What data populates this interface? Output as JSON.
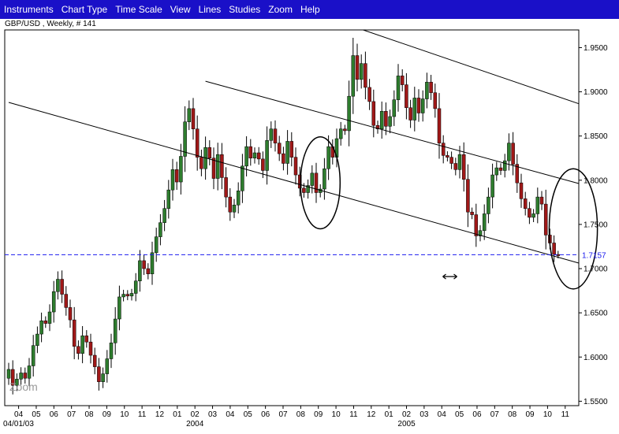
{
  "menu": {
    "items": [
      "Instruments",
      "Chart Type",
      "Time Scale",
      "View",
      "Lines",
      "Studies",
      "Zoom",
      "Help"
    ]
  },
  "chart_title": "GBP/USD , Weekly, # 141",
  "zoom_label": "Zoom",
  "colors": {
    "menubar": "#1a10c8",
    "up_candle": "#2e7d2e",
    "down_candle": "#a01818",
    "price_line": "#1a1aee",
    "trendline": "#000000"
  },
  "chart_data": {
    "type": "candlestick",
    "instrument": "GBP/USD",
    "timeframe": "Weekly",
    "bar_count": 141,
    "ylim": [
      1.545,
      1.97
    ],
    "y_ticks": [
      "1.9500",
      "1.9000",
      "1.8500",
      "1.8000",
      "1.7500",
      "1.7000",
      "1.6500",
      "1.6000",
      "1.5500"
    ],
    "y_tick_values": [
      1.95,
      1.9,
      1.85,
      1.8,
      1.75,
      1.7,
      1.65,
      1.6,
      1.55
    ],
    "current_price_label": "1.7157",
    "current_price": 1.7157,
    "x_month_labels": [
      "04",
      "05",
      "06",
      "07",
      "08",
      "09",
      "10",
      "11",
      "12",
      "01",
      "02",
      "03",
      "04",
      "05",
      "06",
      "07",
      "08",
      "09",
      "10",
      "11",
      "12",
      "01",
      "02",
      "03",
      "04",
      "05",
      "06",
      "07",
      "08",
      "09",
      "10",
      "11"
    ],
    "x_month_positions": [
      0.5,
      4.8,
      9.1,
      13.4,
      17.7,
      22,
      26.3,
      30.6,
      34.9,
      39.2,
      43.5,
      47.8,
      52.1,
      56.4,
      60.7,
      65,
      69.3,
      73.6,
      77.9,
      82.2,
      86.5,
      90.8,
      95.1,
      99.4,
      103.7,
      108,
      112.3,
      116.6,
      120.9,
      125.2,
      129.5,
      133.8
    ],
    "x_year_labels": [
      {
        "label": "04/01/03",
        "at": 0.5
      },
      {
        "label": "2004",
        "at": 43.5
      },
      {
        "label": "2005",
        "at": 95.1
      }
    ],
    "closes": [
      1.586,
      1.568,
      1.575,
      1.582,
      1.576,
      1.59,
      1.613,
      1.626,
      1.641,
      1.638,
      1.651,
      1.674,
      1.688,
      1.671,
      1.656,
      1.642,
      1.612,
      1.604,
      1.624,
      1.617,
      1.602,
      1.589,
      1.572,
      1.581,
      1.598,
      1.616,
      1.643,
      1.668,
      1.671,
      1.669,
      1.672,
      1.686,
      1.709,
      1.7,
      1.694,
      1.718,
      1.736,
      1.752,
      1.768,
      1.789,
      1.812,
      1.798,
      1.827,
      1.866,
      1.881,
      1.858,
      1.826,
      1.813,
      1.837,
      1.825,
      1.802,
      1.829,
      1.803,
      1.781,
      1.764,
      1.772,
      1.788,
      1.816,
      1.838,
      1.825,
      1.831,
      1.824,
      1.811,
      1.845,
      1.858,
      1.842,
      1.83,
      1.819,
      1.844,
      1.826,
      1.806,
      1.791,
      1.786,
      1.794,
      1.808,
      1.786,
      1.79,
      1.813,
      1.838,
      1.826,
      1.847,
      1.858,
      1.856,
      1.895,
      1.941,
      1.914,
      1.932,
      1.905,
      1.889,
      1.862,
      1.858,
      1.878,
      1.861,
      1.872,
      1.891,
      1.918,
      1.908,
      1.882,
      1.868,
      1.893,
      1.876,
      1.892,
      1.911,
      1.899,
      1.881,
      1.842,
      1.828,
      1.826,
      1.819,
      1.812,
      1.829,
      1.801,
      1.764,
      1.761,
      1.737,
      1.743,
      1.762,
      1.781,
      1.806,
      1.814,
      1.811,
      1.822,
      1.842,
      1.818,
      1.797,
      1.779,
      1.768,
      1.758,
      1.762,
      1.781,
      1.773,
      1.738,
      1.729,
      1.716,
      1.7157
    ],
    "trendlines": [
      {
        "from": [
          0,
          1.888
        ],
        "to": [
          140,
          1.705
        ]
      },
      {
        "from": [
          48,
          1.912
        ],
        "to": [
          140,
          1.795
        ]
      },
      {
        "from": [
          77,
          1.985
        ],
        "to": [
          140,
          1.885
        ]
      }
    ],
    "annotations": [
      {
        "type": "ellipse",
        "center": [
          76,
          1.797
        ],
        "rx_bars": 2.3,
        "ry_price": 0.052
      },
      {
        "type": "ellipse",
        "center": [
          137.7,
          1.745
        ],
        "rx_bars": 2.8,
        "ry_price": 0.068
      },
      {
        "type": "double-arrow",
        "at": [
          107.6,
          1.691
        ]
      }
    ]
  }
}
